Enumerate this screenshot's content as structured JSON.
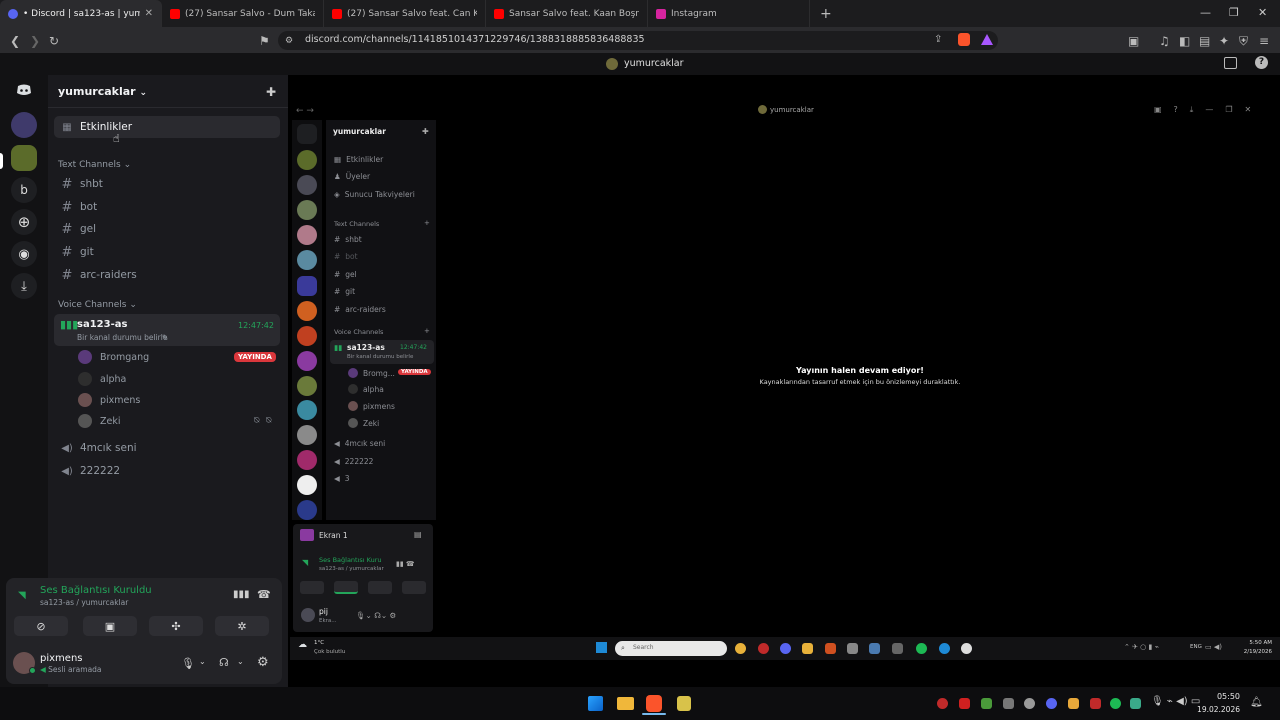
{
  "browser": {
    "tabs": [
      {
        "label": "• Discord | sa123-as | yumurc",
        "active": true
      },
      {
        "label": "(27) Sansar Salvo - Dum Taka Dum"
      },
      {
        "label": "(27) Sansar Salvo feat. Can Kazaz - H"
      },
      {
        "label": "Sansar Salvo feat. Kaan Boşnak (from"
      },
      {
        "label": "Instagram"
      }
    ],
    "url": "discord.com/channels/1141851014371229746/1388318885836488835"
  },
  "window_title": "yumurcaklar",
  "server": {
    "name": "yumurcaklar",
    "events_label": "Etkinlikler",
    "text_category": "Text Channels",
    "text_channels": [
      "shbt",
      "bot",
      "gel",
      "git",
      "arc-raiders"
    ],
    "voice_category": "Voice Channels",
    "active_voice": {
      "name": "sa123-as",
      "time": "12:47:42",
      "status": "Bir kanal durumu belirle"
    },
    "voice_users": [
      {
        "name": "Bromgang",
        "badge": "YAYINDA"
      },
      {
        "name": "alpha"
      },
      {
        "name": "pixmens"
      },
      {
        "name": "Zeki"
      }
    ],
    "other_voice": [
      "4mcık seni",
      "222222"
    ]
  },
  "rail": {
    "letter": "b"
  },
  "voice_panel": {
    "status": "Ses Bağlantısı Kuruldu",
    "location": "sa123-as / yumurcaklar"
  },
  "user": {
    "name": "pixmens",
    "status": "Sesli aramada"
  },
  "share": {
    "title": "yumurcaklar",
    "server_name": "yumurcaklar",
    "items": [
      "Etkinlikler",
      "Üyeler",
      "Sunucu Takviyeleri"
    ],
    "text_category": "Text Channels",
    "text_channels": [
      "shbt",
      "bot",
      "gel",
      "git",
      "arc-raiders"
    ],
    "voice_category": "Voice Channels",
    "voice_channel": "sa123-as",
    "voice_time": "12:47:42",
    "voice_status": "Bir kanal durumu belirle",
    "users": [
      "Bromg...",
      "alpha",
      "pixmens",
      "Zeki"
    ],
    "badge": "YAYINDA",
    "other_voice": [
      "4mcık seni",
      "222222",
      "3"
    ],
    "paused_title": "Yayının halen devam ediyor!",
    "paused_sub": "Kaynaklarından tasarruf etmek için bu önizlemeyi duraklattık.",
    "screen_label": "Ekran 1",
    "conn_status": "Ses Bağlantısı Kuru",
    "conn_loc": "sa123-as / yumurcaklar",
    "mini_user": "pij",
    "mini_user_status": "Ekra...",
    "weather_temp": "1°C",
    "weather_text": "Çok bulutlu",
    "search_placeholder": "Search",
    "lang": "ENG",
    "clock_time": "5:50 AM",
    "clock_date": "2/19/2026"
  },
  "taskbar": {
    "time": "05:50",
    "date": "19.02.2026"
  },
  "colors": {
    "accent_green": "#23a55a",
    "live_red": "#da373c",
    "bg": "#1a1a1e"
  }
}
